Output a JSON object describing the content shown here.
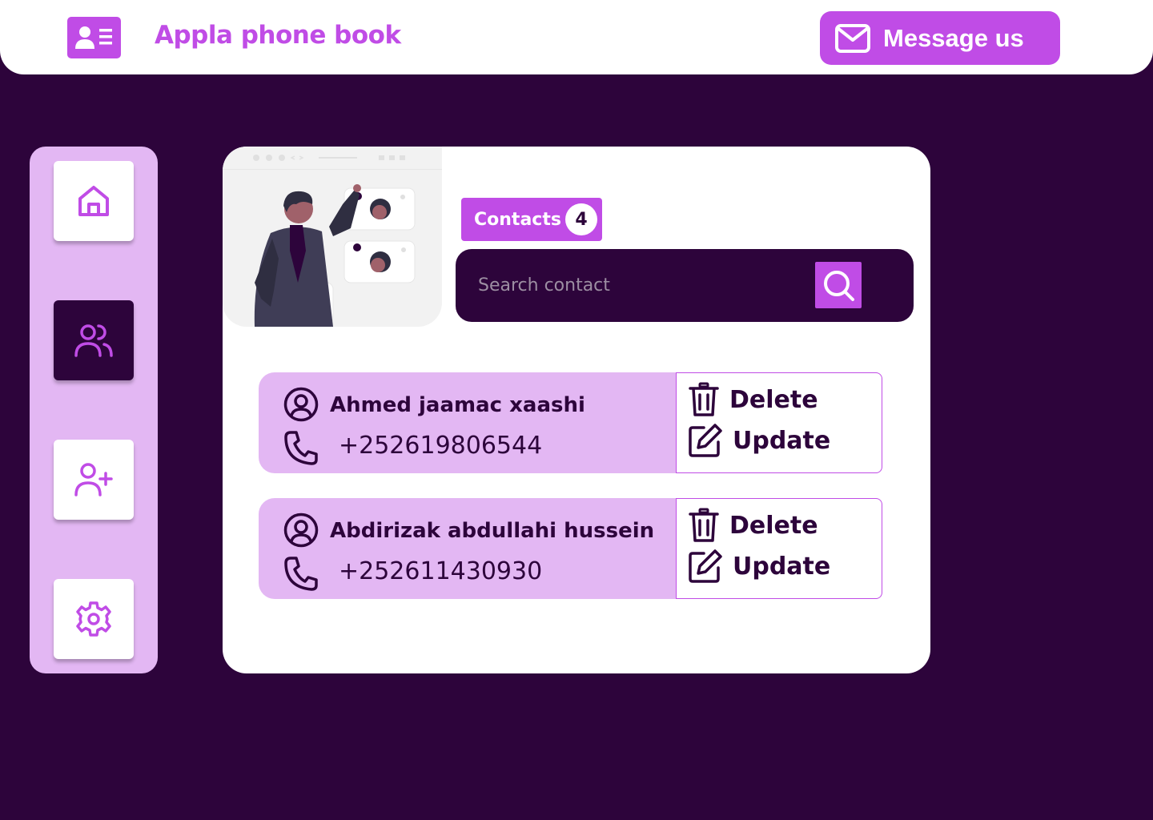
{
  "header": {
    "app_title": "Appla phone book",
    "message_button_label": "Message us",
    "logo_icon": "contact-card-icon",
    "message_icon": "envelope-icon"
  },
  "sidebar": {
    "items": [
      {
        "icon": "home-icon",
        "active": false
      },
      {
        "icon": "users-icon",
        "active": true
      },
      {
        "icon": "user-plus-icon",
        "active": false
      },
      {
        "icon": "gear-icon",
        "active": false
      }
    ]
  },
  "main": {
    "contacts_label": "Contacts",
    "contacts_count": "4",
    "search_placeholder": "Search contact",
    "contacts": [
      {
        "name": "Ahmed jaamac xaashi",
        "phone": "+252619806544",
        "delete_label": "Delete",
        "update_label": "Update"
      },
      {
        "name": "Abdirizak abdullahi hussein",
        "phone": "+252611430930",
        "delete_label": "Delete",
        "update_label": "Update"
      }
    ]
  },
  "colors": {
    "background": "#2d043b",
    "accent": "#c04ce6",
    "light_accent": "#e3b7f3",
    "surface": "#ffffff"
  }
}
